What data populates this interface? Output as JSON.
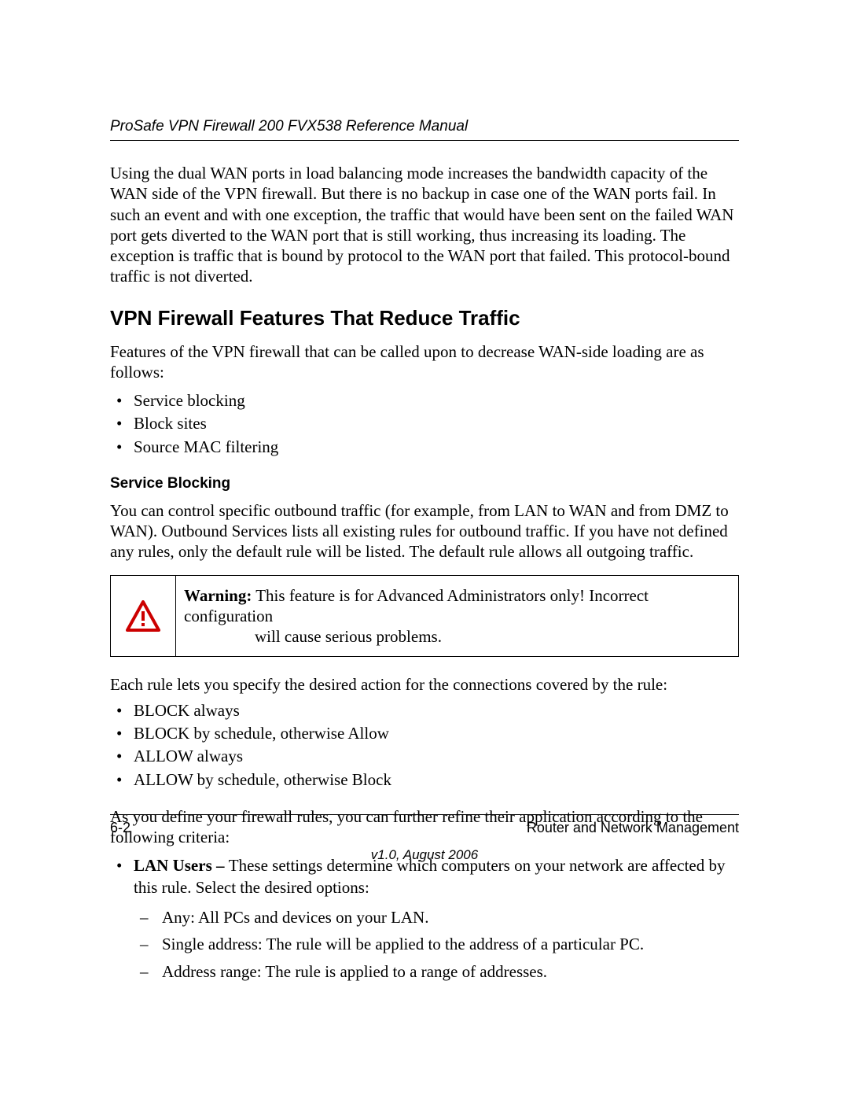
{
  "header": {
    "running_title": "ProSafe VPN Firewall 200 FVX538 Reference Manual"
  },
  "intro_paragraph": "Using the dual WAN ports in load balancing mode increases the bandwidth capacity of the WAN side of the VPN firewall. But there is no backup in case one of the WAN ports fail. In such an event and with one exception, the traffic that would have been sent on the failed WAN port gets diverted to the WAN port that is still working, thus increasing its loading. The exception is traffic that is bound by protocol to the WAN port that failed. This protocol-bound traffic is not diverted.",
  "section": {
    "heading": "VPN Firewall Features That Reduce Traffic",
    "lead": "Features of the VPN firewall that can be called upon to decrease WAN-side loading are as follows:",
    "features": [
      "Service blocking",
      "Block sites",
      "Source MAC filtering"
    ],
    "subheading": "Service Blocking",
    "sub_lead": "You can control specific outbound traffic (for example, from LAN to WAN and from DMZ to WAN). Outbound Services lists all existing rules for outbound traffic. If you have not defined any rules, only the default rule will be listed. The default rule allows all outgoing traffic.",
    "warning": {
      "label": "Warning:",
      "line1": " This feature is for Advanced Administrators only! Incorrect configuration",
      "line2": "will cause serious problems."
    },
    "rules_intro": "Each rule lets you specify the desired action for the connections covered by the rule:",
    "rule_actions": [
      "BLOCK always",
      "BLOCK by schedule, otherwise Allow",
      "ALLOW always",
      "ALLOW by schedule, otherwise Block"
    ],
    "criteria_intro": "As you define your firewall rules, you can further refine their application according to the following criteria:",
    "criteria": {
      "bold": "LAN Users – ",
      "rest": "These settings determine which computers on your network are affected by this rule. Select the desired options:",
      "sub": [
        "Any: All PCs and devices on your LAN.",
        "Single address: The rule will be applied to the address of a particular PC.",
        "Address range: The rule is applied to a range of addresses."
      ]
    }
  },
  "footer": {
    "page_number": "6-2",
    "chapter": "Router and Network Management",
    "version": "v1.0, August 2006"
  }
}
